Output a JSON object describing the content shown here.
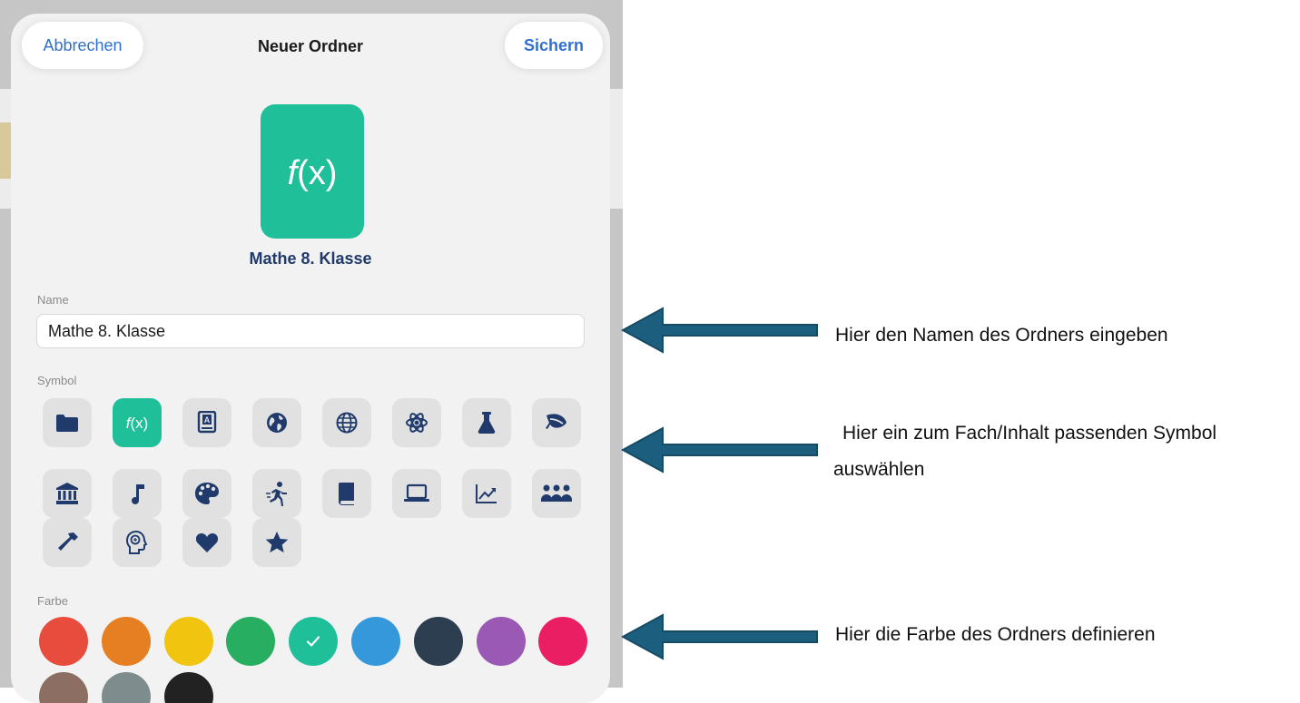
{
  "dialog": {
    "cancel_label": "Abbrechen",
    "title": "Neuer Ordner",
    "save_label": "Sichern"
  },
  "preview": {
    "icon": "function-icon",
    "glyph": "f(x)",
    "color": "#1fbf9a",
    "folder_name": "Mathe 8. Klasse"
  },
  "name_field": {
    "label": "Name",
    "value": "Mathe 8. Klasse"
  },
  "symbol_section": {
    "label": "Symbol",
    "selected": "function-icon",
    "icons": [
      "folder-icon",
      "function-icon",
      "dictionary-book-icon",
      "globe-icon",
      "world-grid-icon",
      "atom-icon",
      "flask-icon",
      "leaf-icon",
      "bank-icon",
      "music-note-icon",
      "palette-icon",
      "running-icon",
      "book-icon",
      "laptop-icon",
      "chart-icon",
      "group-icon",
      "hammer-icon",
      "brain-icon",
      "heart-icon",
      "star-icon"
    ]
  },
  "color_section": {
    "label": "Farbe",
    "selected": "#1fbf9a",
    "colors": [
      "#e74c3c",
      "#e67e22",
      "#f1c40f",
      "#27ae60",
      "#1fbf9a",
      "#3498db",
      "#2c3e50",
      "#9b59b6",
      "#e91e63",
      "#8d6e63",
      "#7f8c8d",
      "#222222"
    ]
  },
  "annotations": {
    "name_hint": "Hier den Namen des Ordners eingeben",
    "symbol_hint_line1": "Hier ein zum Fach/Inhalt passenden Symbol",
    "symbol_hint_line2": "auswählen",
    "color_hint": "Hier die Farbe des Ordners definieren",
    "arrow_color": "#1b5e7e"
  }
}
